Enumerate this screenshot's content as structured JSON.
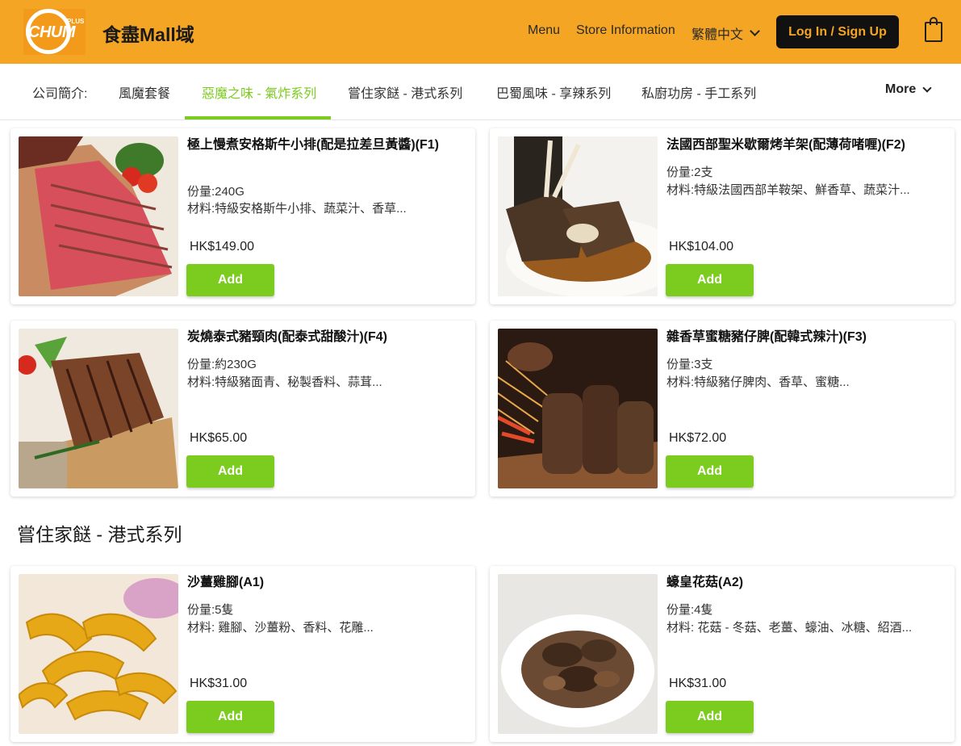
{
  "header": {
    "logo_text": "CHUM",
    "logo_plus": "PLUS",
    "brand": "食盡Mall域",
    "nav_menu": "Menu",
    "nav_store": "Store Information",
    "nav_lang": "繁體中文",
    "login": "Log In / Sign Up",
    "colors": {
      "bar": "#f5a524",
      "login_bg": "#111111",
      "login_text": "#f5a524"
    }
  },
  "categories": {
    "items": [
      {
        "label": "公司簡介:",
        "active": false
      },
      {
        "label": "風魔套餐",
        "active": false
      },
      {
        "label": "惡魔之味 - 氣炸系列",
        "active": true
      },
      {
        "label": "嘗住家餸 - 港式系列",
        "active": false
      },
      {
        "label": "巴蜀風味 - 享辣系列",
        "active": false
      },
      {
        "label": "私廚功房 - 手工系列",
        "active": false
      }
    ],
    "more": "More",
    "accent": "#7ccc1f"
  },
  "products": [
    {
      "title": "極上慢煮安格斯牛小排(配是拉差旦黃醬)(F1)",
      "qty": "份量:240G",
      "materials": "材料:特級安格斯牛小排、蔬菜汁、香草...",
      "price": "HK$149.00",
      "add": "Add",
      "image": "roast-beef"
    },
    {
      "title": "法國西部聖米歇爾烤羊架(配薄荷啫喱)(F2)",
      "qty": "份量:2支",
      "materials": "材料:特級法國西部羊鞍架、鮮香草、蔬菜汁...",
      "price": "HK$104.00",
      "add": "Add",
      "image": "lamb-rack"
    },
    {
      "title": "炭燒泰式豬頸肉(配泰式甜酸汁)(F4)",
      "qty": "份量:約230G",
      "materials": "材料:特級豬面青、秘製香料、蒜茸...",
      "price": "HK$65.00",
      "add": "Add",
      "image": "pork-neck"
    },
    {
      "title": "雜香草蜜糖豬仔脾(配韓式辣汁)(F3)",
      "qty": "份量:3支",
      "materials": "材料:特級豬仔脾肉、香草、蜜糖...",
      "price": "HK$72.00",
      "add": "Add",
      "image": "pork-ribs"
    }
  ],
  "section2": {
    "title": "嘗住家餸 - 港式系列",
    "products": [
      {
        "title": "沙薑雞腳(A1)",
        "qty": "份量:5隻",
        "materials": "材料: 雞腳、沙薑粉、香料、花雕...",
        "price": "HK$31.00",
        "add": "Add",
        "image": "chicken-feet"
      },
      {
        "title": "蠔皇花菇(A2)",
        "qty": "份量:4隻",
        "materials": "材料: 花菇 - 冬菇、老薑、蠔油、冰糖、紹酒...",
        "price": "HK$31.00",
        "add": "Add",
        "image": "mushrooms"
      }
    ]
  }
}
